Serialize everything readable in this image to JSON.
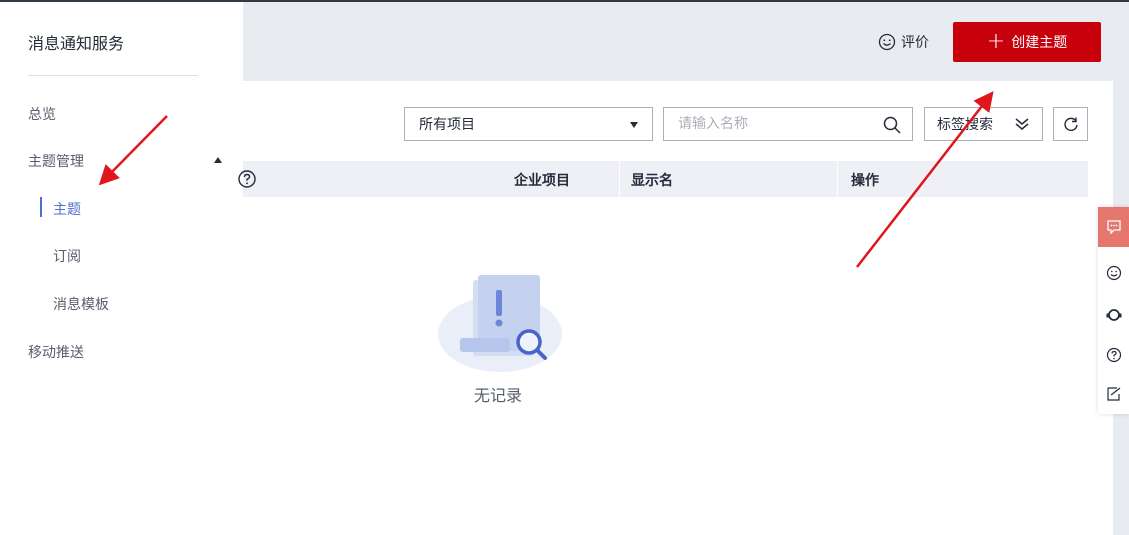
{
  "sidebar": {
    "title": "消息通知服务",
    "items": [
      {
        "label": "总览"
      },
      {
        "label": "主题管理"
      },
      {
        "label": "主题"
      },
      {
        "label": "订阅"
      },
      {
        "label": "消息模板"
      },
      {
        "label": "移动推送"
      }
    ]
  },
  "header": {
    "rate_label": "评价",
    "create_label": "创建主题"
  },
  "filters": {
    "project_select": "所有项目",
    "search_placeholder": "请输入名称",
    "tag_search": "标签搜索"
  },
  "table": {
    "columns": [
      "企业项目",
      "显示名",
      "操作"
    ],
    "empty_text": "无记录"
  },
  "colors": {
    "accent": "#c7000b",
    "active": "#526ecc",
    "annotation_arrow": "#e0161d"
  }
}
